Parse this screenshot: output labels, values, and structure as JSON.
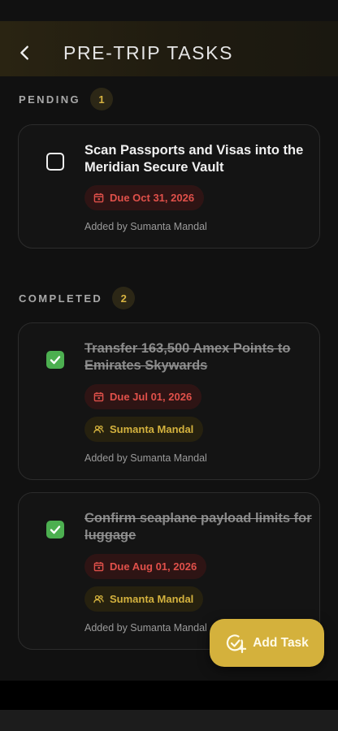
{
  "header": {
    "title": "PRE-TRIP TASKS",
    "back_icon": "chevron-left-icon"
  },
  "sections": {
    "pending": {
      "label": "PENDING",
      "count": "1"
    },
    "completed": {
      "label": "COMPLETED",
      "count": "2"
    }
  },
  "tasks": {
    "pending": [
      {
        "title": "Scan Passports and Visas into the Meridian Secure Vault",
        "due": "Due Oct 31, 2026",
        "added_by": "Added by Sumanta Mandal",
        "checked": false
      }
    ],
    "completed": [
      {
        "title": "Transfer 163,500 Amex Points to Emirates Skywards",
        "due": "Due Jul 01, 2026",
        "assignee": "Sumanta Mandal",
        "added_by": "Added by Sumanta Mandal",
        "checked": true
      },
      {
        "title": "Confirm seaplane payload limits for luggage",
        "due": "Due Aug 01, 2026",
        "assignee": "Sumanta Mandal",
        "added_by": "Added by Sumanta Mandal",
        "checked": true
      }
    ]
  },
  "fab": {
    "label": "Add Task",
    "icon": "add-task-icon"
  },
  "colors": {
    "accent": "#d4b13c",
    "due_text": "#e0504a",
    "check_green": "#4caf50",
    "background": "#111111"
  }
}
